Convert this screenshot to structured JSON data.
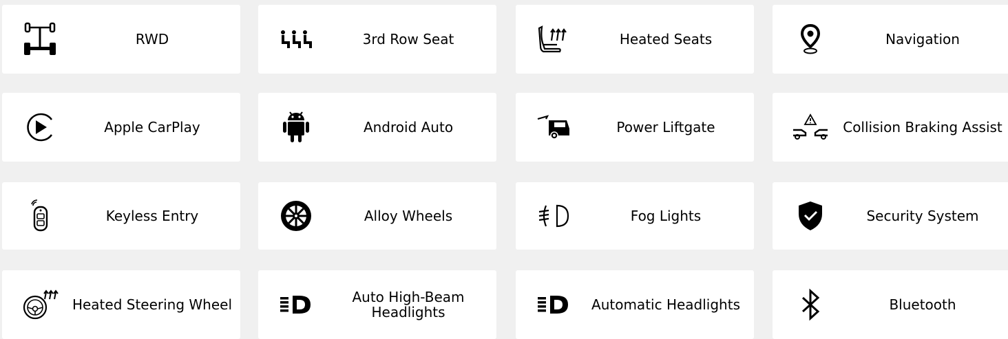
{
  "colors": {
    "background": "#f0f0f0",
    "card": "#ffffff",
    "text": "#000000",
    "icon": "#000000"
  },
  "features": [
    {
      "label": "RWD",
      "icon": "drivetrain-icon"
    },
    {
      "label": "3rd Row Seat",
      "icon": "third-row-seat-icon"
    },
    {
      "label": "Heated Seats",
      "icon": "heated-seat-icon"
    },
    {
      "label": "Navigation",
      "icon": "location-pin-icon"
    },
    {
      "label": "Apple CarPlay",
      "icon": "carplay-icon"
    },
    {
      "label": "Android Auto",
      "icon": "android-icon"
    },
    {
      "label": "Power Liftgate",
      "icon": "liftgate-icon"
    },
    {
      "label": "Collision Braking Assist",
      "icon": "collision-warning-icon"
    },
    {
      "label": "Keyless Entry",
      "icon": "key-fob-icon"
    },
    {
      "label": "Alloy Wheels",
      "icon": "wheel-icon"
    },
    {
      "label": "Fog Lights",
      "icon": "fog-light-icon"
    },
    {
      "label": "Security System",
      "icon": "shield-check-icon"
    },
    {
      "label": "Heated Steering Wheel",
      "icon": "heated-steering-wheel-icon"
    },
    {
      "label": "Auto High-Beam Headlights",
      "icon": "headlight-icon"
    },
    {
      "label": "Automatic Headlights",
      "icon": "headlight-icon"
    },
    {
      "label": "Bluetooth",
      "icon": "bluetooth-icon"
    }
  ]
}
